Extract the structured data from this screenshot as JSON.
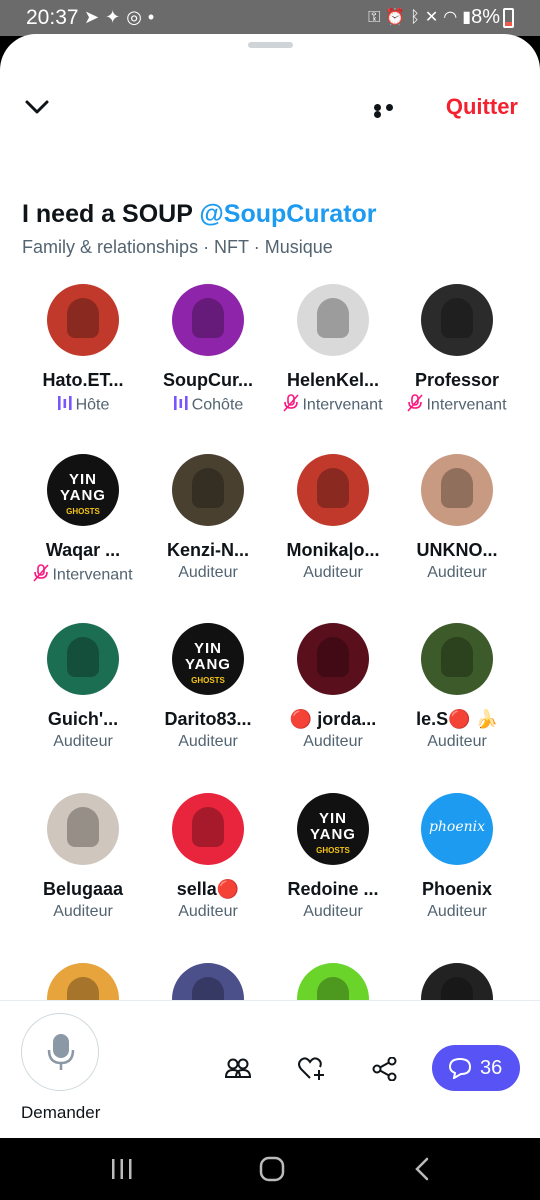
{
  "status_bar": {
    "time": "20:37",
    "battery": "8%",
    "left_icons": [
      "telegram-icon",
      "twitter-icon",
      "sync-icon",
      "dot-icon"
    ],
    "right_icons": [
      "key-icon",
      "alarm-icon",
      "bluetooth-icon",
      "mute-icon",
      "wifi-icon",
      "volte-icon",
      "signal-icon",
      "battery-icon"
    ]
  },
  "header": {
    "quit_label": "Quitter"
  },
  "space": {
    "title": "I need a SOUP",
    "host_handle": "@SoupCurator",
    "topics": "Family & relationships · NFT · Musique"
  },
  "participants": [
    {
      "name": "Hato.ET...",
      "role": "Hôte",
      "role_icon": "host-audio-icon",
      "avatar_color": "#c0392b"
    },
    {
      "name": "SoupCur...",
      "role": "Cohôte",
      "role_icon": "cohost-audio-icon",
      "avatar_color": "#8e24aa"
    },
    {
      "name": "HelenKel...",
      "role": "Intervenant",
      "role_icon": "mic-muted-icon",
      "avatar_color": "#d9d9d9"
    },
    {
      "name": "Professor",
      "role": "Intervenant",
      "role_icon": "mic-muted-icon",
      "avatar_color": "#2b2b2b"
    },
    {
      "name": "Waqar ...",
      "role": "Intervenant",
      "role_icon": "mic-muted-icon",
      "avatar_color": "#111111"
    },
    {
      "name": "Kenzi-N...",
      "role": "Auditeur",
      "avatar_color": "#4a4030"
    },
    {
      "name": "Monika|o...",
      "role": "Auditeur",
      "avatar_color": "#c0392b"
    },
    {
      "name": "UNKNO...",
      "role": "Auditeur",
      "avatar_color": "#c99a82"
    },
    {
      "name": "Guich'...",
      "role": "Auditeur",
      "avatar_color": "#1c6e52"
    },
    {
      "name": "Darito83...",
      "role": "Auditeur",
      "avatar_color": "#111111"
    },
    {
      "name": "🔴 jorda...",
      "role": "Auditeur",
      "avatar_color": "#5a0f1c"
    },
    {
      "name": "le.S🔴 🍌",
      "role": "Auditeur",
      "avatar_color": "#3d5a2a"
    },
    {
      "name": "Belugaaa",
      "role": "Auditeur",
      "avatar_color": "#cfc7bd"
    },
    {
      "name": "sella🔴",
      "role": "Auditeur",
      "avatar_color": "#e8253c"
    },
    {
      "name": "Redoine ...",
      "role": "Auditeur",
      "avatar_color": "#111111"
    },
    {
      "name": "Phoenix",
      "role": "Auditeur",
      "avatar_color": "#1d9bf0"
    },
    {
      "name": "",
      "role": "",
      "avatar_color": "#e7a33c"
    },
    {
      "name": "",
      "role": "",
      "avatar_color": "#4b4f8a"
    },
    {
      "name": "",
      "role": "",
      "avatar_color": "#6bd42b"
    },
    {
      "name": "",
      "role": "",
      "avatar_color": "#222222"
    }
  ],
  "avatar_text": {
    "yin_yang": "YIN YANG",
    "ghosts": "GHOSTS",
    "phoenix": "phoenix"
  },
  "bottom_bar": {
    "request_label": "Demander",
    "chat_count": "36",
    "icons": [
      "people-icon",
      "heart-plus-icon",
      "share-icon",
      "chat-bubble-icon"
    ],
    "chat_color": "#5753f5"
  },
  "colors": {
    "accent": "#1d9bf0",
    "quit": "#f4212e",
    "host_purple": "#7856ff",
    "muted_pink": "#f91880"
  }
}
